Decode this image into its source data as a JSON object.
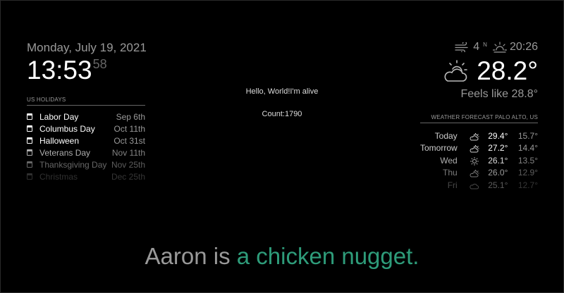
{
  "clock": {
    "date": "Monday, July 19, 2021",
    "time": "13:53",
    "seconds": "58"
  },
  "holidays": {
    "header": "US HOLIDAYS",
    "items": [
      {
        "name": "Labor Day",
        "when": "Sep 6th"
      },
      {
        "name": "Columbus Day",
        "when": "Oct 11th"
      },
      {
        "name": "Halloween",
        "when": "Oct 31st"
      },
      {
        "name": "Veterans Day",
        "when": "Nov 11th"
      },
      {
        "name": "Thanksgiving Day",
        "when": "Nov 25th"
      },
      {
        "name": "Christmas",
        "when": "Dec 25th"
      }
    ]
  },
  "center": {
    "hello": "Hello, World!I'm alive",
    "count": "Count:1790"
  },
  "current_weather": {
    "wind_speed": "4",
    "wind_direction": "N",
    "sunset_time": "20:26",
    "temperature": "28.2°",
    "feels_like": "Feels like 28.8°",
    "condition_icon": "partly-cloudy-day-icon"
  },
  "forecast": {
    "header": "WEATHER FORECAST PALO ALTO, US",
    "days": [
      {
        "day": "Today",
        "icon": "partly-cloudy-icon",
        "high": "29.4°",
        "low": "15.7°"
      },
      {
        "day": "Tomorrow",
        "icon": "partly-cloudy-icon",
        "high": "27.2°",
        "low": "14.4°"
      },
      {
        "day": "Wed",
        "icon": "sunny-icon",
        "high": "26.1°",
        "low": "13.5°"
      },
      {
        "day": "Thu",
        "icon": "partly-cloudy-icon",
        "high": "26.0°",
        "low": "12.9°"
      },
      {
        "day": "Fri",
        "icon": "cloudy-icon",
        "high": "25.1°",
        "low": "12.7°"
      }
    ]
  },
  "compliment": {
    "part1": "Aaron is ",
    "part2": "a chicken nugget."
  },
  "colors": {
    "background": "#000000",
    "primary_text": "#ffffff",
    "dim_text": "#999999",
    "accent": "#2e9c7a"
  }
}
